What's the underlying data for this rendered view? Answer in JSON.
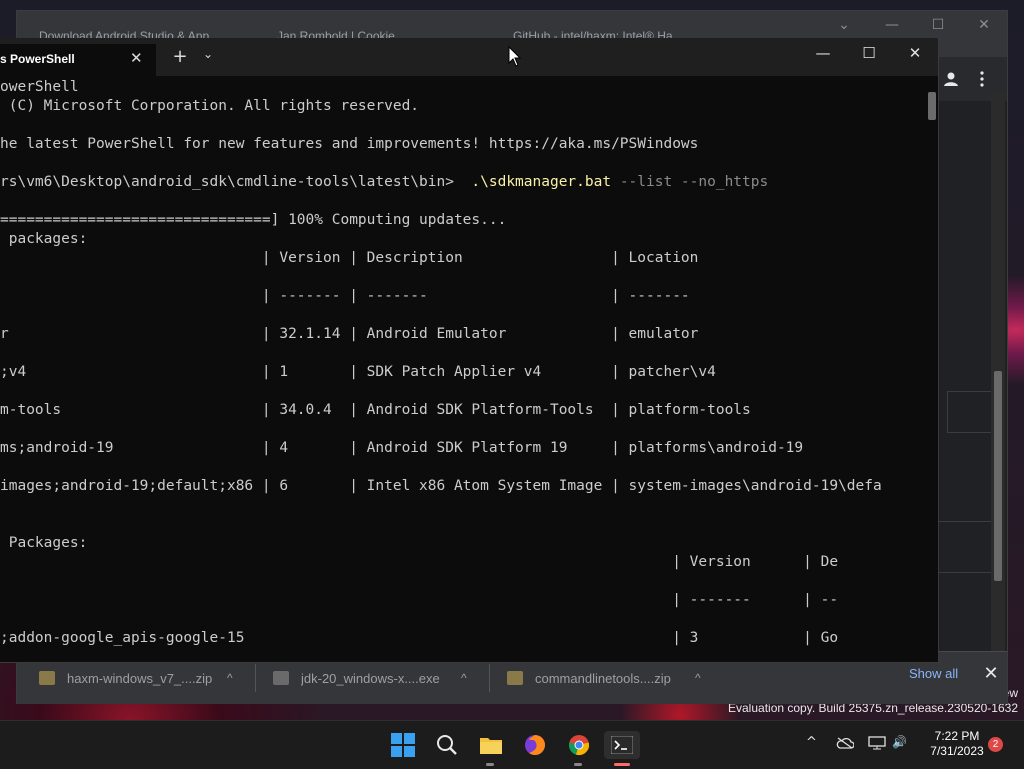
{
  "chrome": {
    "tabs": [
      "Download Android Studio & App",
      "Jan Rombold | Cookie",
      "GitHub - intel/haxm: Intel® Ha"
    ],
    "controls": {
      "list_tabs": "⌄",
      "minimize": "—",
      "maximize": "☐",
      "close": "✕"
    }
  },
  "terminal": {
    "tab_title": "s PowerShell",
    "tab_close": "✕",
    "new_tab": "+",
    "dropdown": "⌄",
    "controls": {
      "minimize": "—",
      "maximize": "☐",
      "close": "✕"
    },
    "lines": [
      "owerShell",
      " (C) Microsoft Corporation. All rights reserved.",
      "",
      "he latest PowerShell for new features and improvements! https://aka.ms/PSWindows",
      "",
      "",
      "===============================] 100% Computing updates...",
      " packages:",
      "                              | Version | Description                 | Location",
      "",
      "                              | ------- | -------                     | -------",
      "",
      "r                             | 32.1.14 | Android Emulator            | emulator",
      "",
      ";v4                           | 1       | SDK Patch Applier v4        | patcher\\v4",
      "",
      "m-tools                       | 34.0.4  | Android SDK Platform-Tools  | platform-tools",
      "",
      "ms;android-19                 | 4       | Android SDK Platform 19     | platforms\\android-19",
      "",
      "images;android-19;default;x86 | 6       | Intel x86 Atom System Image | system-images\\android-19\\defa",
      "",
      "",
      " Packages:",
      "                                                                             | Version      | De",
      "",
      "                                                                             | -------      | --",
      "",
      ";addon-google_apis-google-15                                                 | 3            | Go"
    ],
    "command_line": {
      "prompt": "rs\\vm6\\Desktop\\android_sdk\\cmdline-tools\\latest\\bin>  ",
      "exe": ".\\sdkmanager.bat",
      "params": " --list --no_https"
    }
  },
  "downloads": {
    "items": [
      {
        "name": "haxm-windows_v7_....zip",
        "type": "zip"
      },
      {
        "name": "jdk-20_windows-x....exe",
        "type": "exe"
      },
      {
        "name": "commandlinetools....zip",
        "type": "zip"
      }
    ],
    "show_all": "Show all",
    "close": "✕"
  },
  "desktop": {
    "watermark_line1": "ew",
    "watermark_line2": "Evaluation copy. Build 25375.zn_release.230520-1632"
  },
  "taskbar": {
    "clock_time": "7:22 PM",
    "clock_date": "7/31/2023",
    "notification_count": "2",
    "tray": {
      "overflow": "^",
      "speaker": "🔊"
    }
  },
  "colors": {
    "terminal_bg": "#0c0c0c",
    "command_exe": "#f9f1a5",
    "command_param": "#8a8a8a",
    "link_blue": "#8ab4f8",
    "badge_red": "#e04848"
  }
}
